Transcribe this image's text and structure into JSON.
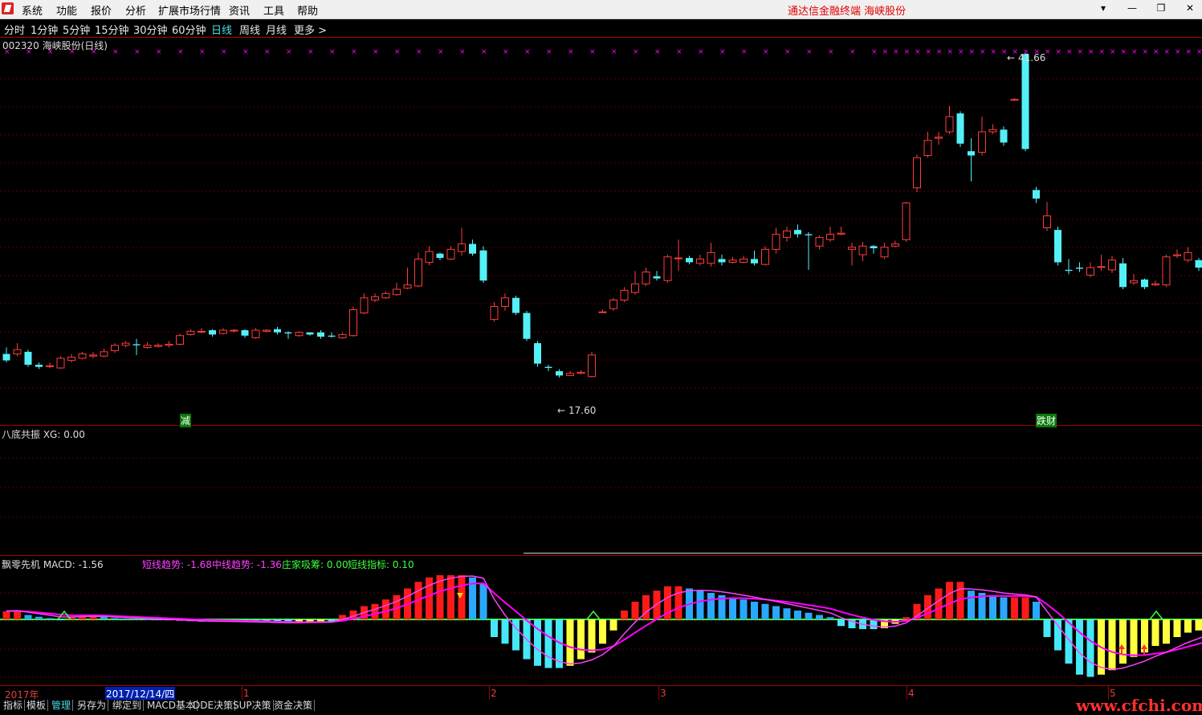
{
  "menubar": {
    "items": [
      "系统",
      "功能",
      "报价",
      "分析",
      "扩展市场行情",
      "资讯",
      "工具",
      "帮助"
    ],
    "brand": "通达信金融终端   海峡股份",
    "controls": [
      "▾",
      "—",
      "❐",
      "✕"
    ]
  },
  "periods": {
    "items": [
      "分时",
      "1分钟",
      "5分钟",
      "15分钟",
      "30分钟",
      "60分钟",
      "日线",
      "周线",
      "月线",
      "更多 >"
    ],
    "active": "日线"
  },
  "main_panel": {
    "title": "002320 海峡股份(日线)",
    "high_label": "41.66",
    "low_label": "17.60",
    "signal_left": "减",
    "signal_right": "跌财"
  },
  "xg_panel": {
    "title": "八底共振 XG: 0.00"
  },
  "macd_panel": {
    "title": "飘零先机 MACD: -1.56",
    "short_trend": "短线趋势: -1.68",
    "mid_trend": "中线趋势: -1.36",
    "zhuangjia": "庄家吸筹: 0.00",
    "short_index": "短线指标: 0.10"
  },
  "date_axis": {
    "year": "2017年",
    "cursor": "2017/12/14/四",
    "months": [
      "1",
      "2",
      "3",
      "4",
      "5"
    ]
  },
  "tabs": {
    "items": [
      "指标",
      "模板",
      "管理",
      "另存为",
      "绑定到",
      "MACD基本",
      "DDE决策",
      "SUP决策",
      "资金决策"
    ],
    "active": "管理"
  },
  "watermark": "www.cfchi.com",
  "chart_data": {
    "type": "candlestick",
    "colors": {
      "up": "#ff3b3b",
      "down": "#54f0f8",
      "ma": "#ff00ff",
      "cross": "#ff00ff"
    },
    "ohlc": [
      [
        27.8,
        27.2,
        28.4,
        27.0
      ],
      [
        27.8,
        28.2,
        28.8,
        27.6
      ],
      [
        28.0,
        26.8,
        28.2,
        26.6
      ],
      [
        26.8,
        26.6,
        27.0,
        26.4
      ],
      [
        26.7,
        26.7,
        27.0,
        26.5
      ],
      [
        26.5,
        27.4,
        27.6,
        26.4
      ],
      [
        27.2,
        27.5,
        27.8,
        27.0
      ],
      [
        27.4,
        27.8,
        28.0,
        27.3
      ],
      [
        27.6,
        27.7,
        28.0,
        27.4
      ],
      [
        27.6,
        28.0,
        28.3,
        27.5
      ],
      [
        28.1,
        28.6,
        28.8,
        27.9
      ],
      [
        28.6,
        28.8,
        29.0,
        28.4
      ],
      [
        28.7,
        28.6,
        29.2,
        27.7
      ],
      [
        28.4,
        28.6,
        28.9,
        28.3
      ],
      [
        28.5,
        28.6,
        28.8,
        28.4
      ],
      [
        28.6,
        28.7,
        29.0,
        28.4
      ],
      [
        28.7,
        29.5,
        29.7,
        28.6
      ],
      [
        29.6,
        29.9,
        30.1,
        29.5
      ],
      [
        29.9,
        29.9,
        30.2,
        29.7
      ],
      [
        30.0,
        29.6,
        30.1,
        29.4
      ],
      [
        29.7,
        30.0,
        30.2,
        29.6
      ],
      [
        30.0,
        30.0,
        30.1,
        29.8
      ],
      [
        30.0,
        29.5,
        30.1,
        29.3
      ],
      [
        29.3,
        30.0,
        30.2,
        29.2
      ],
      [
        29.9,
        30.0,
        30.1,
        29.8
      ],
      [
        30.1,
        29.8,
        30.3,
        29.6
      ],
      [
        29.8,
        29.7,
        29.9,
        29.2
      ],
      [
        29.5,
        29.8,
        29.9,
        29.4
      ],
      [
        29.8,
        29.6,
        29.8,
        29.5
      ],
      [
        29.8,
        29.4,
        30.0,
        29.2
      ],
      [
        29.5,
        29.4,
        29.8,
        29.3
      ],
      [
        29.3,
        29.6,
        29.8,
        29.2
      ],
      [
        29.5,
        31.9,
        32.2,
        29.4
      ],
      [
        31.6,
        33.0,
        33.4,
        31.5
      ],
      [
        32.8,
        33.1,
        33.4,
        32.6
      ],
      [
        33.0,
        33.4,
        33.6,
        32.9
      ],
      [
        33.3,
        33.8,
        34.4,
        33.2
      ],
      [
        33.9,
        34.2,
        35.8,
        33.8
      ],
      [
        34.1,
        36.6,
        37.2,
        34.0
      ],
      [
        36.3,
        37.3,
        37.8,
        36.0
      ],
      [
        37.1,
        36.7,
        37.2,
        36.5
      ],
      [
        36.6,
        37.5,
        37.8,
        36.5
      ],
      [
        37.3,
        38.0,
        39.5,
        36.9
      ],
      [
        38.0,
        37.1,
        38.4,
        36.9
      ],
      [
        37.4,
        34.6,
        37.8,
        34.4
      ],
      [
        31.0,
        32.2,
        32.6,
        30.8
      ],
      [
        32.2,
        33.0,
        33.4,
        31.8
      ],
      [
        33.0,
        31.6,
        33.2,
        31.4
      ],
      [
        31.6,
        29.2,
        31.8,
        29.0
      ],
      [
        28.8,
        26.9,
        29.0,
        26.6
      ],
      [
        26.6,
        26.5,
        26.8,
        26.2
      ],
      [
        26.2,
        25.8,
        26.4,
        25.6
      ],
      [
        25.8,
        26.0,
        26.2,
        25.8
      ],
      [
        26.0,
        26.1,
        26.3,
        25.9
      ],
      [
        25.7,
        27.7,
        28.0,
        25.6
      ],
      [
        31.7,
        31.7,
        31.9,
        31.6
      ],
      [
        32.0,
        32.8,
        33.0,
        31.8
      ],
      [
        32.8,
        33.7,
        34.0,
        32.6
      ],
      [
        33.5,
        34.3,
        35.5,
        33.3
      ],
      [
        34.3,
        35.4,
        35.8,
        34.1
      ],
      [
        35.0,
        34.8,
        35.5,
        34.6
      ],
      [
        34.6,
        36.8,
        37.0,
        34.4
      ],
      [
        36.7,
        36.7,
        38.4,
        35.5
      ],
      [
        36.7,
        36.3,
        36.9,
        36.1
      ],
      [
        36.2,
        36.6,
        37.0,
        36.0
      ],
      [
        36.2,
        37.2,
        38.1,
        35.9
      ],
      [
        36.6,
        36.3,
        37.0,
        36.0
      ],
      [
        36.3,
        36.5,
        36.8,
        36.2
      ],
      [
        36.3,
        36.6,
        36.9,
        36.2
      ],
      [
        36.6,
        36.2,
        37.4,
        36.0
      ],
      [
        36.1,
        37.5,
        37.8,
        36.0
      ],
      [
        37.5,
        38.9,
        39.5,
        37.1
      ],
      [
        38.6,
        39.2,
        39.6,
        38.2
      ],
      [
        39.3,
        38.9,
        39.8,
        38.6
      ],
      [
        38.9,
        38.8,
        39.1,
        35.6
      ],
      [
        37.8,
        38.6,
        38.8,
        37.5
      ],
      [
        38.4,
        38.9,
        39.6,
        38.2
      ],
      [
        38.9,
        39.0,
        39.6,
        38.8
      ],
      [
        37.5,
        37.7,
        38.1,
        36.0
      ],
      [
        37.0,
        37.8,
        38.2,
        36.4
      ],
      [
        37.8,
        37.6,
        37.9,
        37.1
      ],
      [
        36.8,
        37.7,
        38.1,
        36.6
      ],
      [
        37.8,
        38.0,
        38.3,
        37.7
      ],
      [
        38.4,
        41.8,
        41.9,
        38.2
      ],
      [
        43.2,
        46.0,
        46.3,
        42.8
      ],
      [
        46.2,
        47.6,
        48.4,
        46.0
      ],
      [
        47.8,
        47.9,
        48.4,
        47.2
      ],
      [
        48.4,
        49.8,
        50.8,
        48.2
      ],
      [
        50.1,
        47.3,
        50.3,
        47.0
      ],
      [
        46.6,
        46.2,
        47.8,
        43.8
      ],
      [
        46.5,
        48.4,
        49.8,
        46.2
      ],
      [
        48.4,
        48.6,
        49.1,
        48.2
      ],
      [
        48.6,
        47.4,
        48.9,
        47.1
      ],
      [
        51.4,
        51.4,
        51.5,
        51.3
      ],
      [
        55.6,
        46.8,
        55.7,
        46.6
      ],
      [
        43.0,
        42.2,
        43.3,
        41.8
      ],
      [
        39.5,
        40.6,
        41.9,
        39.2
      ],
      [
        39.3,
        36.3,
        39.6,
        36.0
      ],
      [
        35.6,
        35.5,
        36.6,
        35.2
      ],
      [
        35.8,
        35.7,
        36.3,
        35.4
      ],
      [
        35.1,
        35.8,
        36.3,
        34.9
      ],
      [
        35.9,
        35.9,
        37.0,
        35.5
      ],
      [
        35.6,
        36.5,
        36.9,
        35.3
      ],
      [
        36.2,
        34.0,
        36.7,
        33.8
      ],
      [
        34.4,
        34.6,
        35.2,
        34.2
      ],
      [
        34.7,
        34.0,
        34.8,
        33.8
      ],
      [
        34.2,
        34.3,
        34.6,
        34.1
      ],
      [
        34.2,
        36.8,
        37.0,
        34.0
      ],
      [
        36.9,
        37.0,
        37.5,
        36.7
      ],
      [
        36.5,
        37.2,
        37.7,
        36.3
      ],
      [
        36.5,
        35.8,
        36.7,
        35.5
      ],
      [
        34.3,
        33.4,
        34.6,
        33.2
      ]
    ],
    "macd_hist": [
      0.18,
      0.2,
      0.1,
      0.06,
      0.03,
      -0.02,
      0.05,
      0.08,
      0.08,
      0.06,
      0.03,
      0.02,
      0.01,
      0.0,
      -0.01,
      -0.02,
      -0.03,
      -0.04,
      -0.05,
      -0.05,
      -0.05,
      -0.05,
      -0.06,
      -0.06,
      -0.07,
      -0.08,
      -0.08,
      -0.07,
      -0.06,
      -0.05,
      -0.05,
      0.1,
      0.2,
      0.3,
      0.35,
      0.45,
      0.55,
      0.7,
      0.85,
      0.95,
      1.0,
      1.0,
      1.0,
      0.95,
      0.8,
      -0.4,
      -0.55,
      -0.7,
      -0.9,
      -1.05,
      -1.1,
      -1.1,
      -1.05,
      -0.9,
      -0.75,
      -0.55,
      -0.25,
      0.2,
      0.4,
      0.55,
      0.65,
      0.75,
      0.75,
      0.7,
      0.65,
      0.6,
      0.55,
      0.5,
      0.45,
      0.4,
      0.35,
      0.3,
      0.25,
      0.2,
      0.15,
      0.1,
      0.05,
      -0.15,
      -0.2,
      -0.22,
      -0.22,
      -0.2,
      -0.1,
      0.05,
      0.35,
      0.55,
      0.7,
      0.85,
      0.85,
      0.65,
      0.6,
      0.55,
      0.5,
      0.5,
      0.5,
      0.4,
      -0.4,
      -0.7,
      -1.0,
      -1.25,
      -1.3,
      -1.25,
      -1.15,
      -1.0,
      -0.85,
      -0.75,
      -0.6,
      -0.55,
      -0.4,
      -0.3,
      -0.25,
      -0.15,
      -0.15,
      -0.15,
      -0.15,
      -0.15
    ]
  }
}
